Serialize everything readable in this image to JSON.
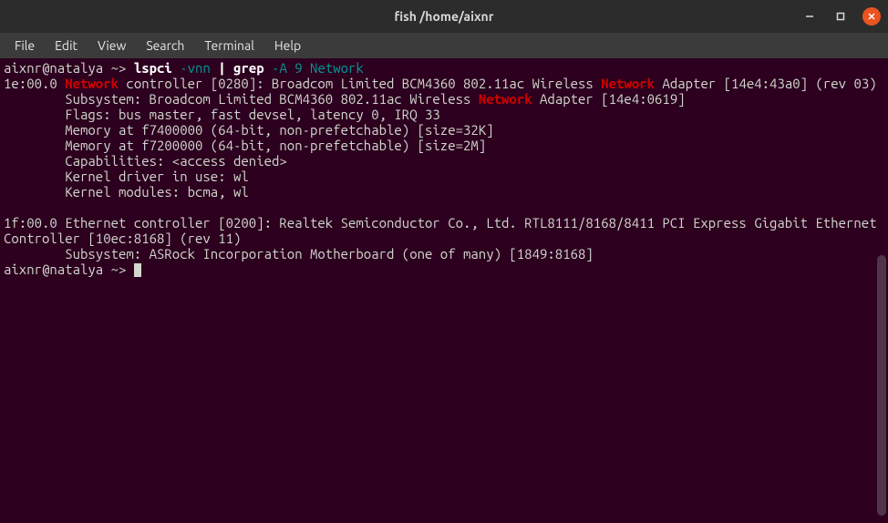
{
  "window": {
    "title": "fish  /home/aixnr"
  },
  "menubar": {
    "items": [
      "File",
      "Edit",
      "View",
      "Search",
      "Terminal",
      "Help"
    ]
  },
  "prompt": {
    "user_host": "aixnr@natalya",
    "sep": " ~> "
  },
  "command": {
    "cmd1": "lspci",
    "args1": " -vnn ",
    "pipe": "|",
    "cmd2": " grep",
    "args2": " -A 9 Network"
  },
  "output": {
    "l1a": "1e:00.0 ",
    "l1_hl1": "Network",
    "l1b": " controller [0280]: Broadcom Limited BCM4360 802.11ac Wireless ",
    "l1_hl2": "Network",
    "l1c": " Adapter [14e4:43a0] (rev 03)",
    "l2a": "        Subsystem: Broadcom Limited BCM4360 802.11ac Wireless ",
    "l2_hl1": "Network",
    "l2b": " Adapter [14e4:0619]",
    "l3": "        Flags: bus master, fast devsel, latency 0, IRQ 33",
    "l4": "        Memory at f7400000 (64-bit, non-prefetchable) [size=32K]",
    "l5": "        Memory at f7200000 (64-bit, non-prefetchable) [size=2M]",
    "l6": "        Capabilities: <access denied>",
    "l7": "        Kernel driver in use: wl",
    "l8": "        Kernel modules: bcma, wl",
    "blank": "",
    "l9": "1f:00.0 Ethernet controller [0200]: Realtek Semiconductor Co., Ltd. RTL8111/8168/8411 PCI Express Gigabit Ethernet Controller [10ec:8168] (rev 11)",
    "l10": "        Subsystem: ASRock Incorporation Motherboard (one of many) [1849:8168]"
  }
}
